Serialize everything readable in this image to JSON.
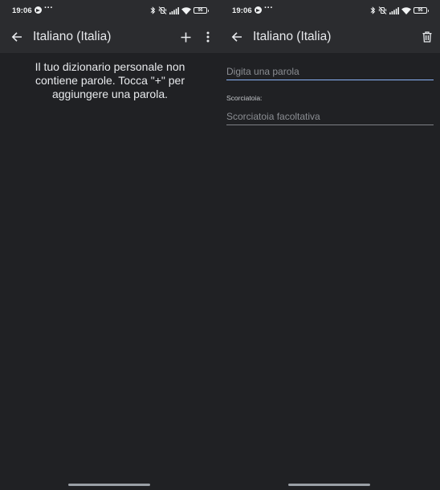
{
  "status_bar": {
    "time": "19:06",
    "overflow_dots": "···",
    "battery_level": "96",
    "icons": [
      "telegram-icon",
      "bluetooth-icon",
      "vibrate-off-icon",
      "signal-icon",
      "wifi-icon",
      "battery-icon"
    ]
  },
  "left_screen": {
    "app_bar": {
      "title": "Italiano (Italia)",
      "icons": [
        "arrow-back-icon",
        "plus-icon",
        "more-vert-icon"
      ]
    },
    "empty_message": "Il tuo dizionario personale non contiene parole. Tocca \"+\" per aggiungere una parola."
  },
  "right_screen": {
    "app_bar": {
      "title": "Italiano (Italia)",
      "icons": [
        "arrow-back-icon",
        "trash-icon"
      ]
    },
    "word_field": {
      "placeholder": "Digita una parola",
      "value": ""
    },
    "shortcut_label": "Scorciatoia:",
    "shortcut_field": {
      "placeholder": "Scorciatoia facoltativa",
      "value": ""
    }
  },
  "colors": {
    "background": "#202124",
    "app_bar": "#2b2c2f",
    "text": "#e8eaed",
    "accent": "#8ab4f8",
    "hint": "#8b8e93"
  }
}
